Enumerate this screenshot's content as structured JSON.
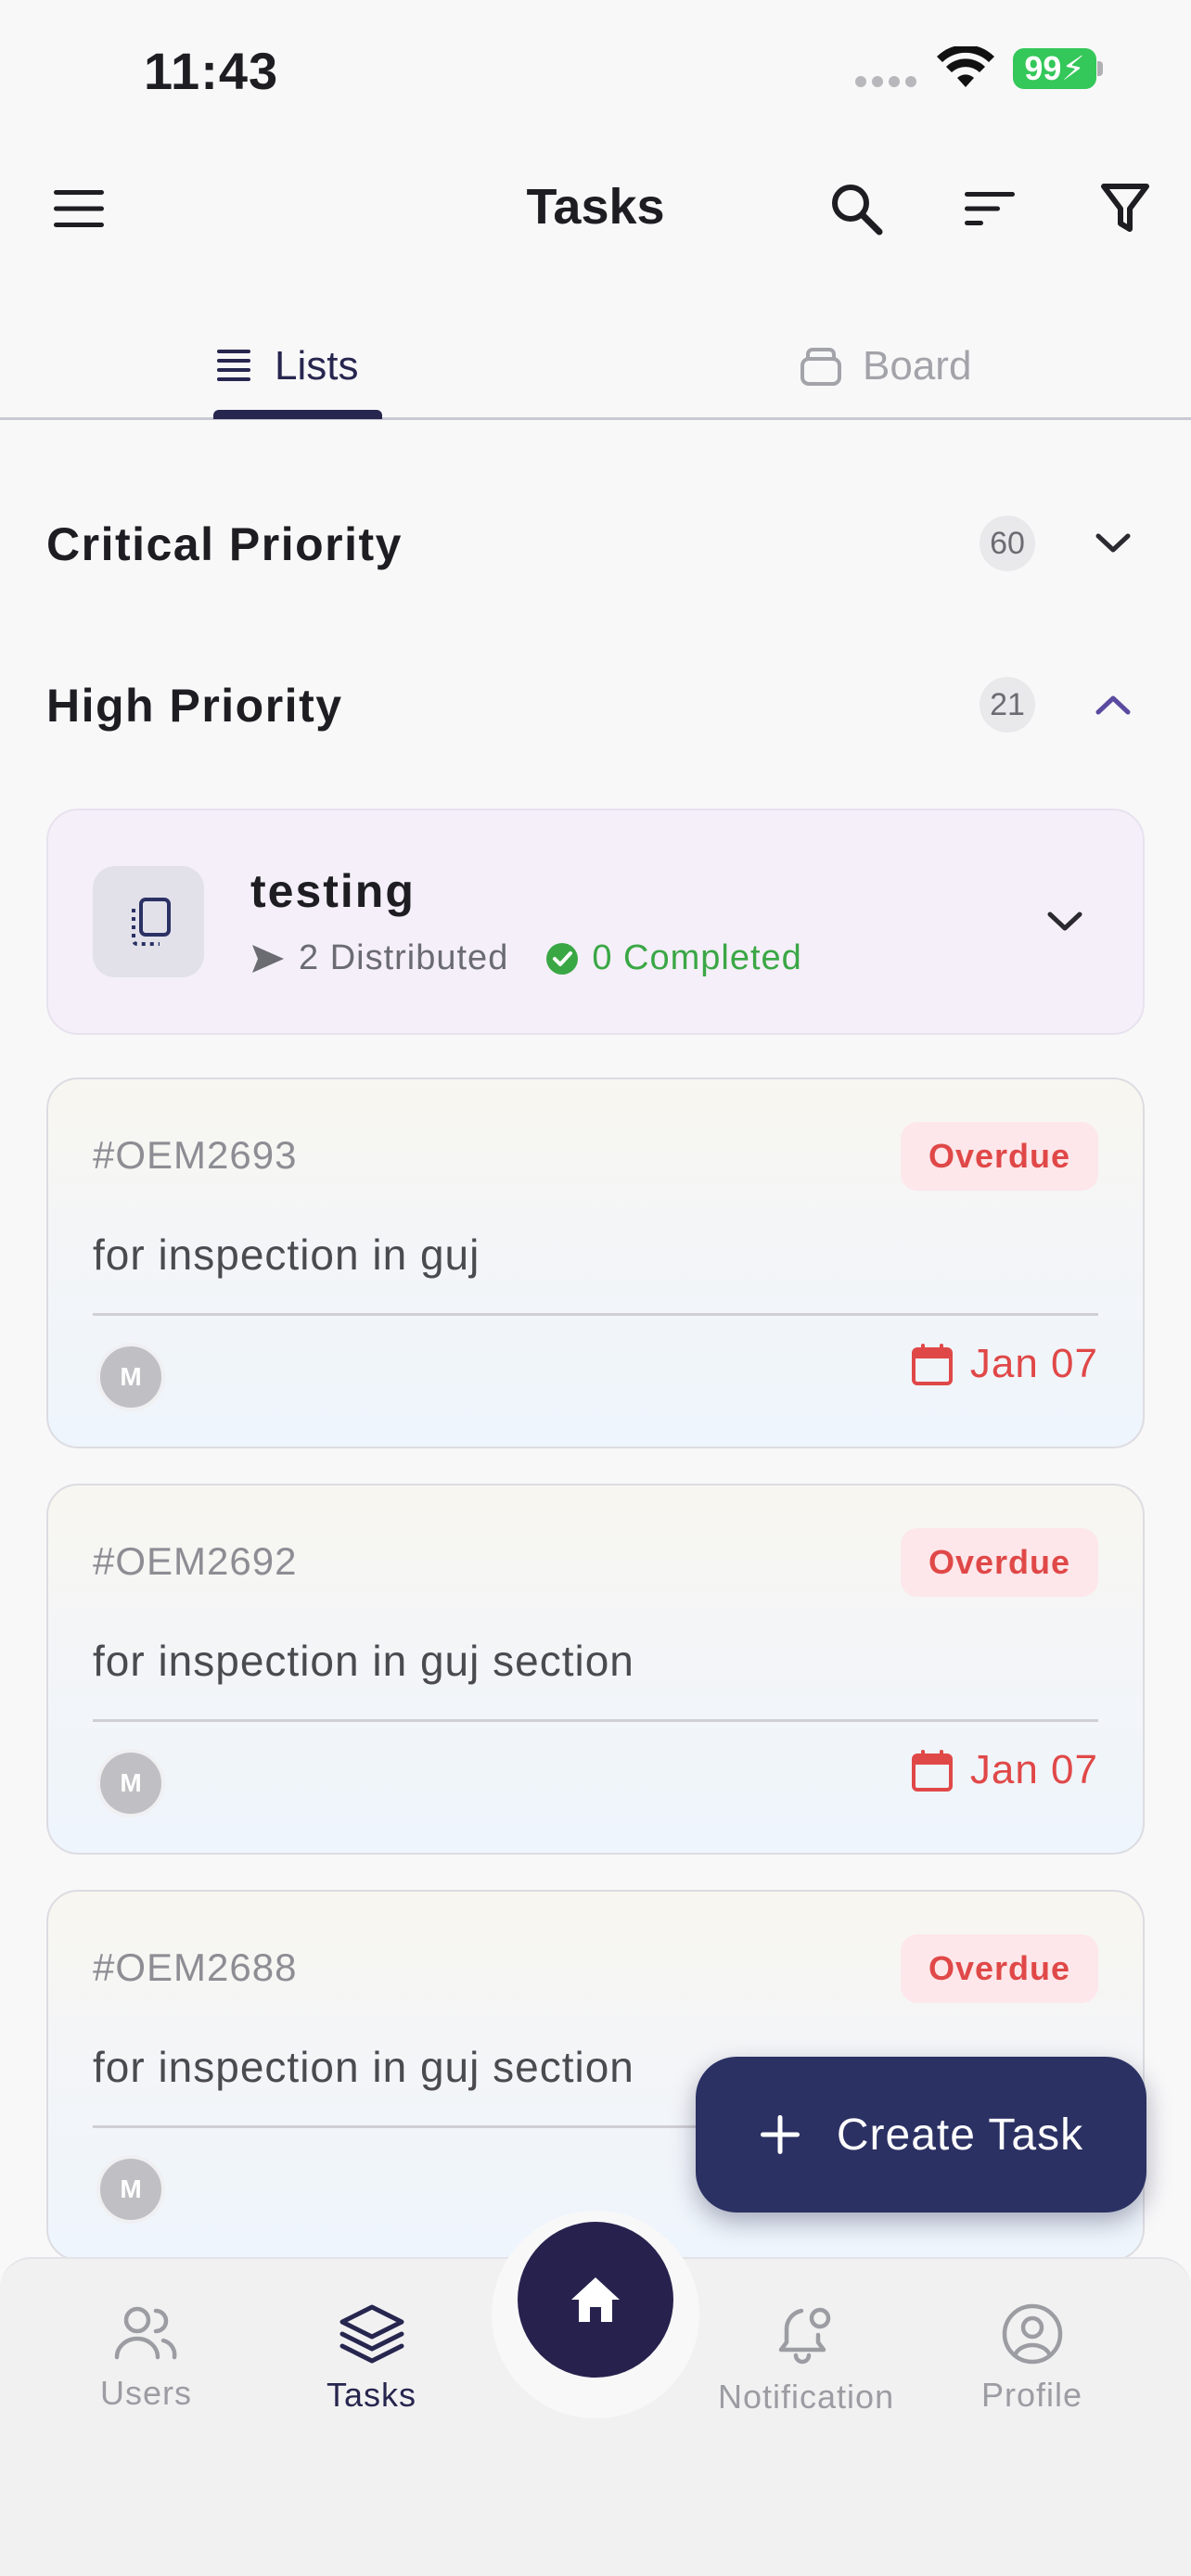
{
  "status_bar": {
    "time": "11:43",
    "battery": "99"
  },
  "header": {
    "title": "Tasks"
  },
  "tabs": [
    {
      "label": "Lists",
      "active": true,
      "icon": "list-icon"
    },
    {
      "label": "Board",
      "active": false,
      "icon": "board-icon"
    }
  ],
  "groups": {
    "critical": {
      "title": "Critical Priority",
      "count": "60",
      "expanded": false
    },
    "high": {
      "title": "High Priority",
      "count": "21",
      "expanded": true
    }
  },
  "project": {
    "name": "testing",
    "distributed": "2 Distributed",
    "completed": "0 Completed"
  },
  "tasks": [
    {
      "id": "#OEM2693",
      "status": "Overdue",
      "title": "for inspection  in guj",
      "assignee_initial": "M",
      "due": "Jan 07"
    },
    {
      "id": "#OEM2692",
      "status": "Overdue",
      "title": "for inspection  in guj section",
      "assignee_initial": "M",
      "due": "Jan 07"
    },
    {
      "id": "#OEM2688",
      "status": "Overdue",
      "title": "for inspection  in guj section",
      "assignee_initial": "M",
      "due": ""
    }
  ],
  "fab": {
    "label": "Create Task"
  },
  "bottom_nav": [
    {
      "label": "Users",
      "icon": "users-icon",
      "active": false
    },
    {
      "label": "Tasks",
      "icon": "layers-icon",
      "active": true
    },
    {
      "label": "Notification",
      "icon": "bell-icon",
      "active": false
    },
    {
      "label": "Profile",
      "icon": "profile-icon",
      "active": false
    }
  ],
  "colors": {
    "primary": "#27264f",
    "overdue": "#e04848",
    "completed": "#3aa745",
    "fab": "#2b3163"
  }
}
